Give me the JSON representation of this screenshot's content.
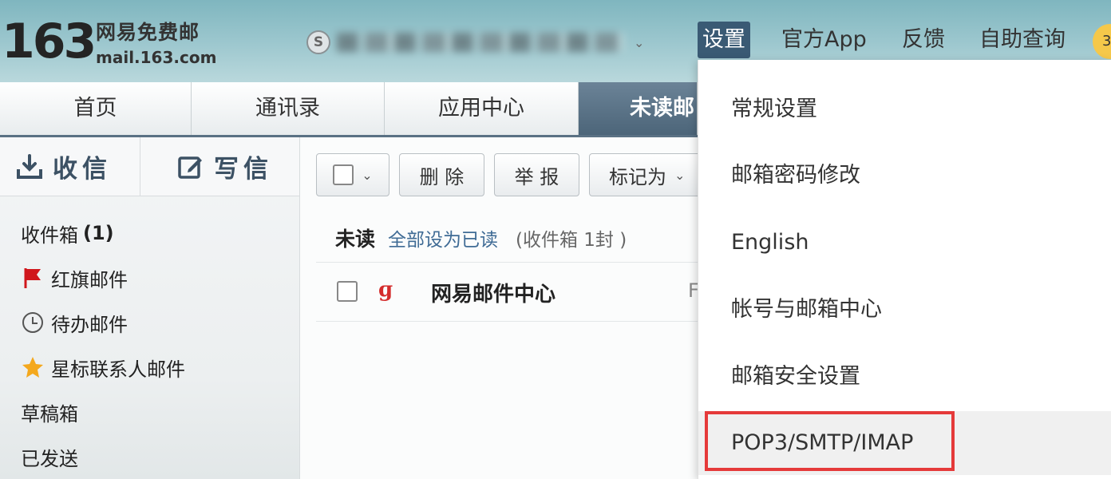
{
  "header": {
    "logo_number": "163",
    "logo_cn": "网易免费邮",
    "logo_domain": "mail.163.com",
    "account_coin_glyph": "S",
    "account_caret": "⌄",
    "nav": [
      "设置",
      "官方App",
      "反馈",
      "自助查询"
    ],
    "avatar_initial": "3"
  },
  "tabs": [
    {
      "label": "首页"
    },
    {
      "label": "通讯录"
    },
    {
      "label": "应用中心"
    },
    {
      "label": "未读邮"
    }
  ],
  "sidebar": {
    "receive_label": "收信",
    "compose_label": "写信",
    "folders": [
      {
        "label": "收件箱",
        "count": "(1)",
        "icon": "none"
      },
      {
        "label": "红旗邮件",
        "icon": "red-flag-icon"
      },
      {
        "label": "待办邮件",
        "icon": "clock-icon"
      },
      {
        "label": "星标联系人邮件",
        "icon": "star-icon"
      },
      {
        "label": "草稿箱",
        "icon": "none"
      },
      {
        "label": "已发送",
        "icon": "none"
      }
    ]
  },
  "toolbar": {
    "select_caret": "⌄",
    "delete_label": "删 除",
    "report_label": "举 报",
    "markas_label": "标记为",
    "markas_caret": "⌄"
  },
  "list": {
    "title": "未读",
    "mark_all_read": "全部设为已读",
    "summary": "(收件箱 1封 )",
    "rows": [
      {
        "sender_logo": "ɡ",
        "sender": "网易邮件中心",
        "preview_cut": "F"
      }
    ]
  },
  "settings_menu": {
    "items": [
      "常规设置",
      "邮箱密码修改",
      "English",
      "帐号与邮箱中心",
      "邮箱安全设置",
      "POP3/SMTP/IMAP"
    ],
    "highlighted_index": 5
  },
  "colors": {
    "header_bg": "#9ec8cf",
    "active_nav": "#3a5a74",
    "accent_link": "#3f6b95",
    "highlight_box": "#e53a3a",
    "flag_red": "#d0171c",
    "star_yellow": "#f4a81d"
  }
}
